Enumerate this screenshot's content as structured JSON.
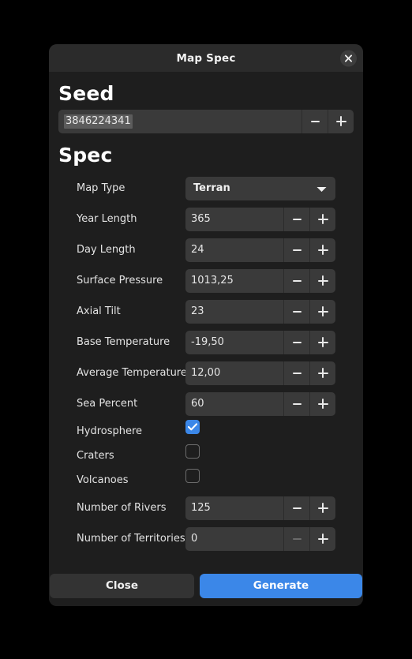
{
  "dialog": {
    "title": "Map Spec",
    "close_icon": "close-icon"
  },
  "seed_section": {
    "heading": "Seed",
    "value": "3846224341",
    "decrement_label": "−",
    "increment_label": "+"
  },
  "spec_section": {
    "heading": "Spec",
    "fields": [
      {
        "label": "Map Type",
        "type": "select",
        "value": "Terran",
        "icon": "chevron-down-icon"
      },
      {
        "label": "Year Length",
        "type": "stepper",
        "value": "365",
        "minus_enabled": true,
        "plus_enabled": true
      },
      {
        "label": "Day Length",
        "type": "stepper",
        "value": "24",
        "minus_enabled": true,
        "plus_enabled": true
      },
      {
        "label": "Surface Pressure",
        "type": "stepper",
        "value": "1013,25",
        "minus_enabled": true,
        "plus_enabled": true
      },
      {
        "label": "Axial Tilt",
        "type": "stepper",
        "value": "23",
        "minus_enabled": true,
        "plus_enabled": true
      },
      {
        "label": "Base Temperature",
        "type": "stepper",
        "value": "-19,50",
        "minus_enabled": true,
        "plus_enabled": true
      },
      {
        "label": "Average Temperature",
        "type": "stepper",
        "value": "12,00",
        "minus_enabled": true,
        "plus_enabled": true
      },
      {
        "label": "Sea Percent",
        "type": "stepper",
        "value": "60",
        "minus_enabled": true,
        "plus_enabled": true
      },
      {
        "label": "Hydrosphere",
        "type": "checkbox",
        "checked": true
      },
      {
        "label": "Craters",
        "type": "checkbox",
        "checked": false
      },
      {
        "label": "Volcanoes",
        "type": "checkbox",
        "checked": false
      },
      {
        "label": "Number of Rivers",
        "type": "stepper",
        "value": "125",
        "minus_enabled": true,
        "plus_enabled": true
      },
      {
        "label": "Number of Territories",
        "type": "stepper",
        "value": "0",
        "minus_enabled": false,
        "plus_enabled": true
      }
    ]
  },
  "footer": {
    "close_label": "Close",
    "generate_label": "Generate"
  },
  "colors": {
    "accent": "#3b87e8",
    "dialog_background": "#1e1e1e",
    "titlebar_background": "#2b2b2b",
    "control_background": "#3a3a3a",
    "page_background": "#000000",
    "text_primary": "#f0f0f0"
  }
}
